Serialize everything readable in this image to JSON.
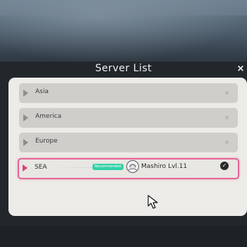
{
  "dialog": {
    "title": "Server List",
    "close_label": "×"
  },
  "servers": [
    {
      "name": "Asia",
      "selected": false
    },
    {
      "name": "America",
      "selected": false
    },
    {
      "name": "Europe",
      "selected": false
    },
    {
      "name": "SEA",
      "selected": true,
      "badge": "Recommended",
      "player_name": "Mashiro",
      "player_level": "Lvl.11"
    }
  ],
  "icons": {
    "server": "play-triangle-icon",
    "status": "square-dot-icon",
    "selected": "check-circle-icon",
    "avatar": "player-avatar-icon",
    "close": "close-icon",
    "cursor": "mouse-cursor-icon"
  },
  "colors": {
    "accent": "#e36596",
    "badge": "#2fd2a7",
    "row": "#cfceca",
    "panel": "#ecebe8",
    "dialog": "#22272c"
  }
}
